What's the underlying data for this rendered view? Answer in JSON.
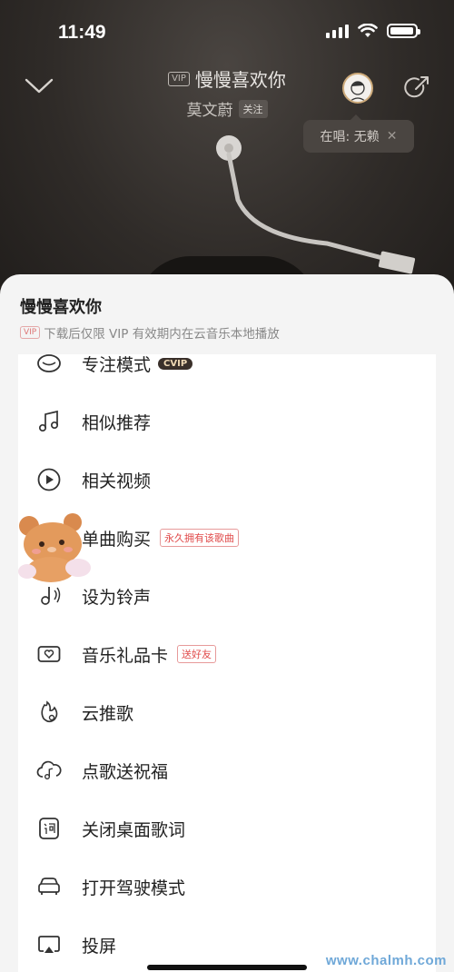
{
  "status_bar": {
    "time": "11:49",
    "battery_percent": 95
  },
  "player": {
    "vip_tag": "VIP",
    "song_title": "慢慢喜欢你",
    "artist": "莫文蔚",
    "follow_label": "关注",
    "singing_prefix": "在唱: ",
    "singing_name": "无赖",
    "singing_close": "✕"
  },
  "sheet": {
    "title": "慢慢喜欢你",
    "vip_tag": "VIP",
    "subtitle": "下载后仅限 VIP 有效期内在云音乐本地播放"
  },
  "menu": [
    {
      "label": "专注模式",
      "icon": "focus-icon",
      "badge": "",
      "cvip": "CVIP"
    },
    {
      "label": "相似推荐",
      "icon": "music-notes-icon",
      "badge": ""
    },
    {
      "label": "相关视频",
      "icon": "video-play-icon",
      "badge": ""
    },
    {
      "label": "单曲购买",
      "icon": "purchase-icon",
      "badge": "永久拥有该歌曲"
    },
    {
      "label": "设为铃声",
      "icon": "ringtone-icon",
      "badge": ""
    },
    {
      "label": "音乐礼品卡",
      "icon": "gift-card-icon",
      "badge": "送好友"
    },
    {
      "label": "云推歌",
      "icon": "cloud-push-icon",
      "badge": ""
    },
    {
      "label": "点歌送祝福",
      "icon": "cloud-note-icon",
      "badge": ""
    },
    {
      "label": "关闭桌面歌词",
      "icon": "lyrics-icon",
      "badge": ""
    },
    {
      "label": "打开驾驶模式",
      "icon": "car-icon",
      "badge": ""
    },
    {
      "label": "投屏",
      "icon": "cast-icon",
      "badge": ""
    }
  ],
  "watermark": "www.chalmh.com"
}
